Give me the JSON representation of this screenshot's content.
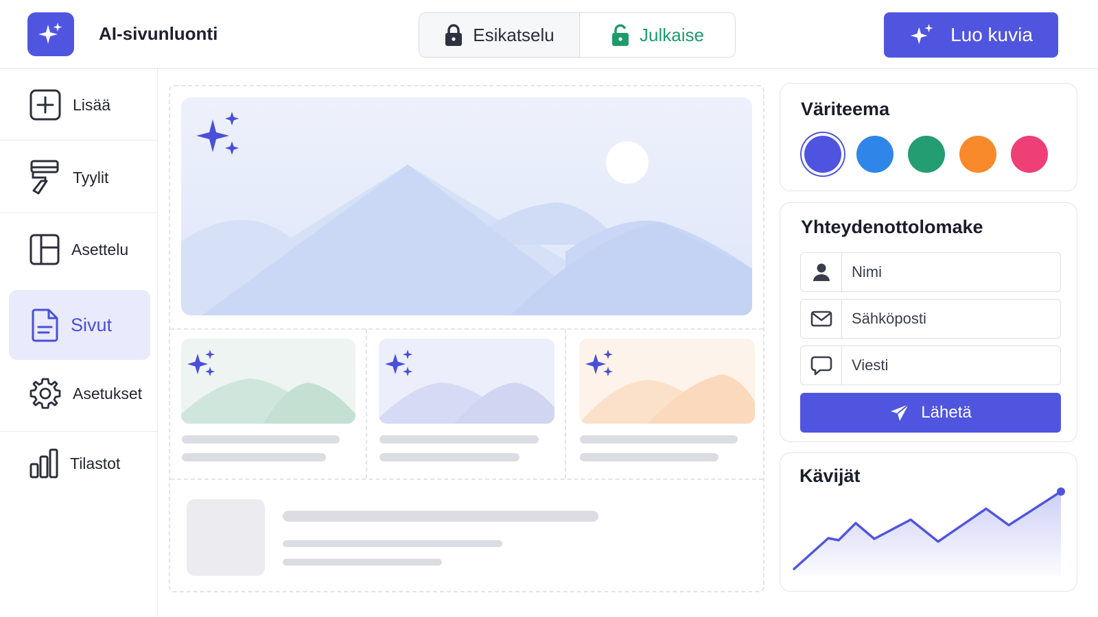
{
  "header": {
    "app_title": "AI-sivunluonti",
    "logo_icon": "sparkle-icon",
    "preview_label": "Esikatselu",
    "preview_icon": "lock-icon",
    "publish_label": "Julkaise",
    "publish_icon": "unlock-icon",
    "create_images_label": "Luo kuvia",
    "create_images_icon": "sparkle-icon"
  },
  "sidebar": {
    "items": [
      {
        "label": "Lisää",
        "icon": "add-icon"
      },
      {
        "label": "Tyylit",
        "icon": "paint-roller-icon"
      },
      {
        "label": "Asettelu",
        "icon": "layout-icon"
      },
      {
        "label": "Sivut",
        "icon": "page-icon",
        "active": true
      },
      {
        "label": "Asetukset",
        "icon": "gear-icon"
      },
      {
        "label": "Tilastot",
        "icon": "bar-chart-icon"
      }
    ]
  },
  "theme_panel": {
    "title": "Väriteema",
    "colors": [
      "#4f54e0",
      "#2f86e8",
      "#259d72",
      "#f98a2c",
      "#ee3f77"
    ],
    "selected_index": 0
  },
  "contact_form": {
    "title": "Yhteydenottolomake",
    "fields": [
      {
        "placeholder": "Nimi",
        "icon": "person-icon"
      },
      {
        "placeholder": "Sähköposti",
        "icon": "mail-icon"
      },
      {
        "placeholder": "Viesti",
        "icon": "chat-icon"
      }
    ],
    "submit_label": "Lähetä",
    "submit_icon": "send-icon"
  },
  "visitors": {
    "title": "Kävijät"
  },
  "colors": {
    "accent": "#5055e0",
    "publish_green": "#1e9b6a"
  }
}
